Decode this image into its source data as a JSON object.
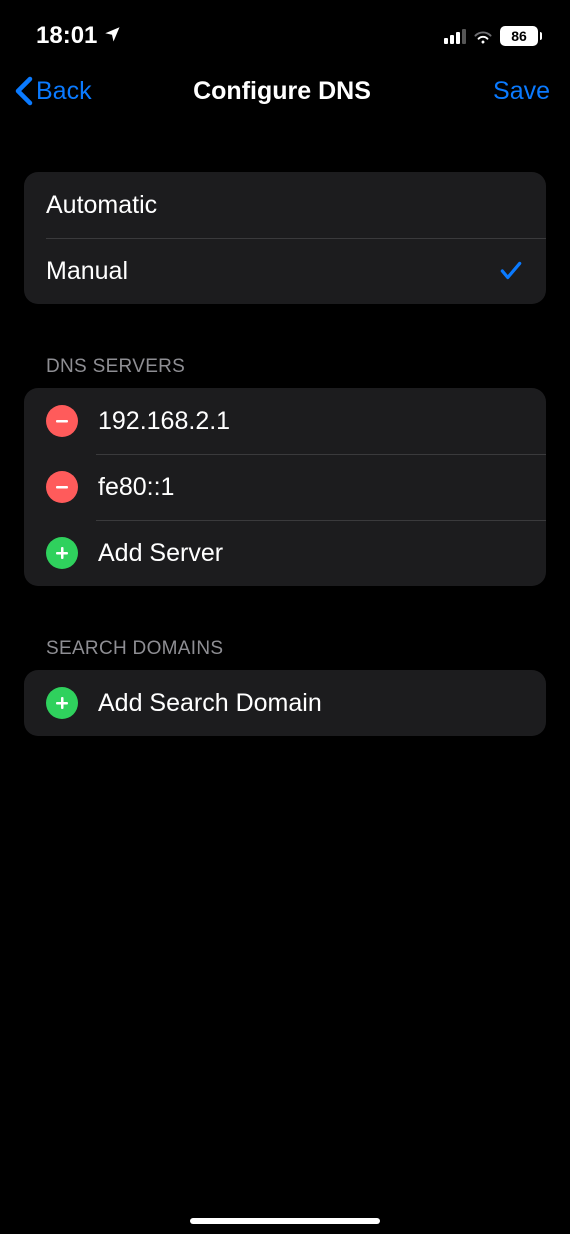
{
  "status_bar": {
    "time": "18:01",
    "battery_percent": "86"
  },
  "nav": {
    "back_label": "Back",
    "title": "Configure DNS",
    "save_label": "Save"
  },
  "mode_group": {
    "options": [
      {
        "label": "Automatic",
        "selected": false
      },
      {
        "label": "Manual",
        "selected": true
      }
    ]
  },
  "dns_section": {
    "header": "DNS SERVERS",
    "servers": [
      "192.168.2.1",
      "fe80::1"
    ],
    "add_label": "Add Server"
  },
  "search_section": {
    "header": "SEARCH DOMAINS",
    "add_label": "Add Search Domain"
  }
}
